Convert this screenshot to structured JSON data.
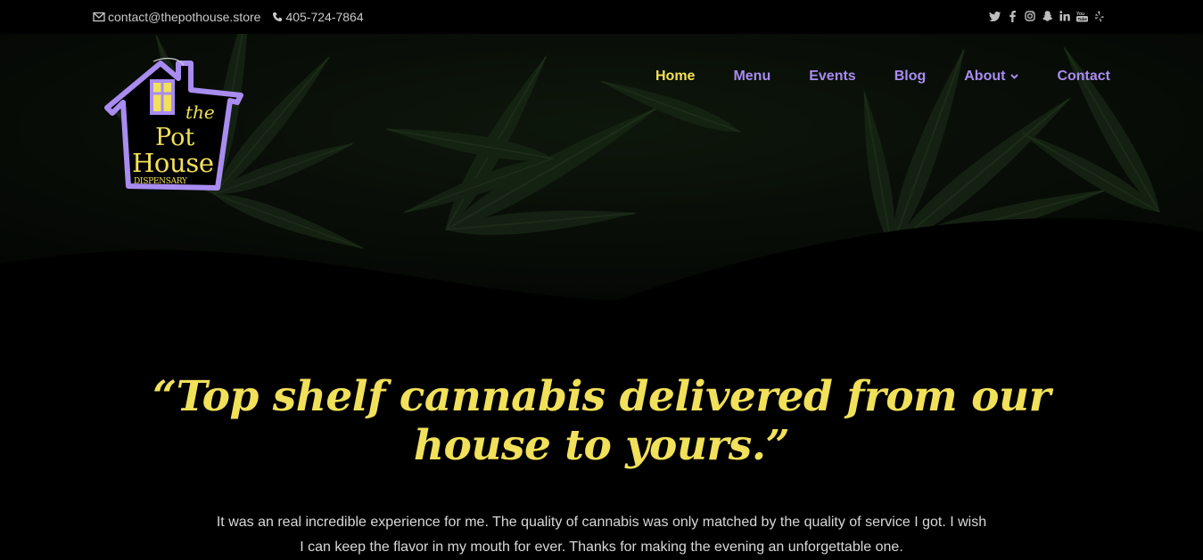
{
  "topbar": {
    "email": "contact@thepothouse.store",
    "phone": "405-724-7864",
    "social_icons": [
      "twitter-icon",
      "facebook-icon",
      "instagram-icon",
      "snapchat-icon",
      "linkedin-icon",
      "youtube-icon",
      "yelp-icon"
    ]
  },
  "logo": {
    "line1": "the",
    "line2": "Pot",
    "line3": "House",
    "line4": "DISPENSARY"
  },
  "nav": {
    "items": [
      {
        "label": "Home",
        "active": true
      },
      {
        "label": "Menu"
      },
      {
        "label": "Events"
      },
      {
        "label": "Blog"
      },
      {
        "label": "About",
        "has_dropdown": true
      },
      {
        "label": "Contact"
      }
    ]
  },
  "hero": {
    "quote_line1": "“Top shelf cannabis delivered from our",
    "quote_line2": "house to yours.”",
    "testimonial_line1": "It was an real incredible experience for me. The quality of cannabis was only matched by the quality of service I got. I wish",
    "testimonial_line2": "I can keep the flavor in my mouth for ever. Thanks for making the evening an unforgettable one."
  },
  "colors": {
    "accent_yellow": "#f1e05a",
    "accent_purple": "#a98cf0",
    "background": "#000000"
  }
}
